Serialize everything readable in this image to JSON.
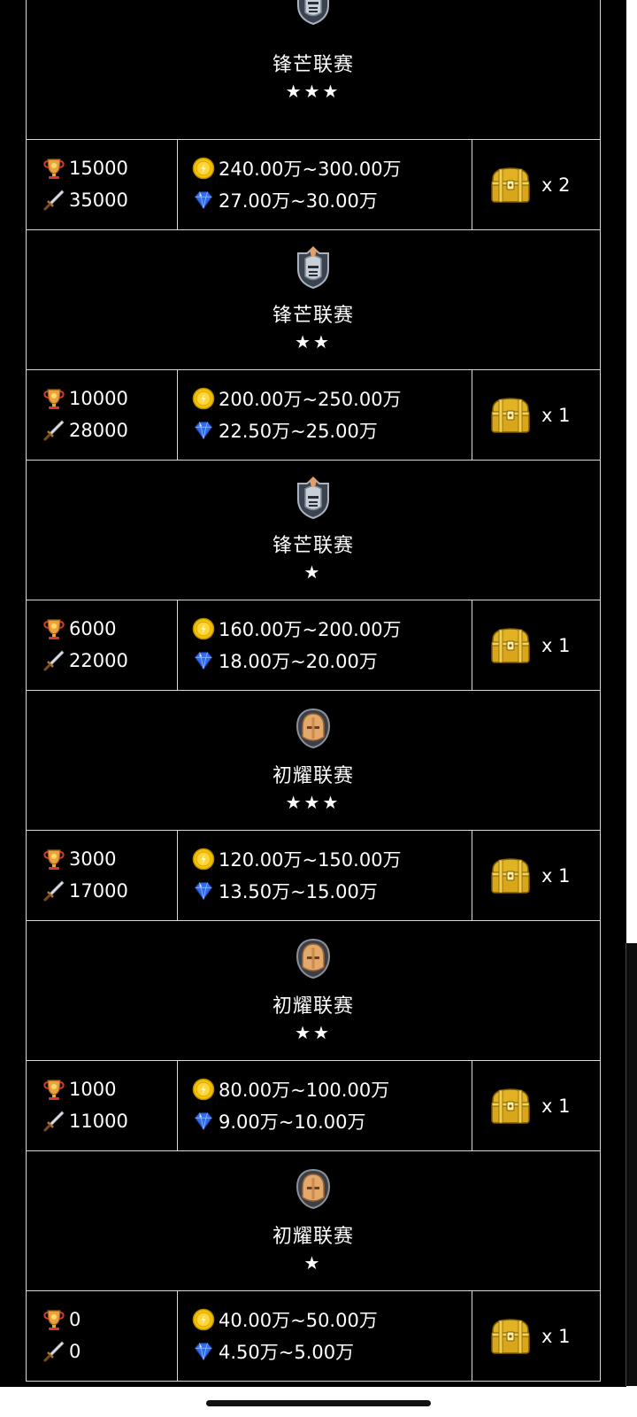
{
  "colors": {
    "background": "#000000",
    "grid_line": "#d9d9d9",
    "gold": "#f3c200",
    "diamond": "#2f6cf0",
    "trophy": "#e8a33a",
    "emblem_steel": "#9aa3ad",
    "emblem_bronze": "#d79a5c"
  },
  "tiers": [
    {
      "league": "锋芒联赛",
      "stars": "★★★",
      "emblem": "steel-knight-emblem",
      "trophy": "15000",
      "power": "35000",
      "gold_range": "240.00万~300.00万",
      "diamond_range": "27.00万~30.00万",
      "chest": "x 2"
    },
    {
      "league": "锋芒联赛",
      "stars": "★★",
      "emblem": "steel-knight-emblem",
      "trophy": "10000",
      "power": "28000",
      "gold_range": "200.00万~250.00万",
      "diamond_range": "22.50万~25.00万",
      "chest": "x 1"
    },
    {
      "league": "锋芒联赛",
      "stars": "★",
      "emblem": "steel-knight-emblem",
      "trophy": "6000",
      "power": "22000",
      "gold_range": "160.00万~200.00万",
      "diamond_range": "18.00万~20.00万",
      "chest": "x 1"
    },
    {
      "league": "初耀联赛",
      "stars": "★★★",
      "emblem": "bronze-knight-emblem",
      "trophy": "3000",
      "power": "17000",
      "gold_range": "120.00万~150.00万",
      "diamond_range": "13.50万~15.00万",
      "chest": "x 1"
    },
    {
      "league": "初耀联赛",
      "stars": "★★",
      "emblem": "bronze-knight-emblem",
      "trophy": "1000",
      "power": "11000",
      "gold_range": "80.00万~100.00万",
      "diamond_range": "9.00万~10.00万",
      "chest": "x 1"
    },
    {
      "league": "初耀联赛",
      "stars": "★",
      "emblem": "bronze-knight-emblem",
      "trophy": "0",
      "power": "0",
      "gold_range": "40.00万~50.00万",
      "diamond_range": "4.50万~5.00万",
      "chest": "x 1"
    }
  ]
}
